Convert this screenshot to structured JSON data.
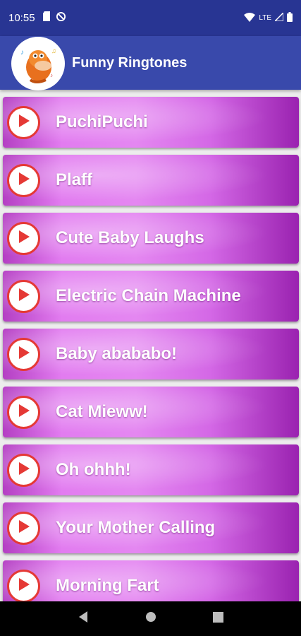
{
  "status_bar": {
    "time": "10:55",
    "network": "LTE"
  },
  "app_bar": {
    "title": "Funny Ringtones"
  },
  "ringtones": [
    {
      "label": "PuchiPuchi"
    },
    {
      "label": "Plaff"
    },
    {
      "label": "Cute Baby Laughs"
    },
    {
      "label": "Electric Chain Machine"
    },
    {
      "label": "Baby abababo!"
    },
    {
      "label": "Cat Mieww!"
    },
    {
      "label": "Oh ohhh!"
    },
    {
      "label": "Your Mother Calling"
    },
    {
      "label": "Morning Fart"
    }
  ],
  "colors": {
    "status_bar": "#283593",
    "app_bar": "#3949ab",
    "play_ring": "#e53935",
    "item_purple": "#d468e6"
  },
  "icons": [
    "sd-card-icon",
    "no-sync-icon",
    "wifi-icon",
    "signal-icon",
    "battery-icon",
    "play-icon",
    "back-icon",
    "home-icon",
    "recents-icon"
  ]
}
